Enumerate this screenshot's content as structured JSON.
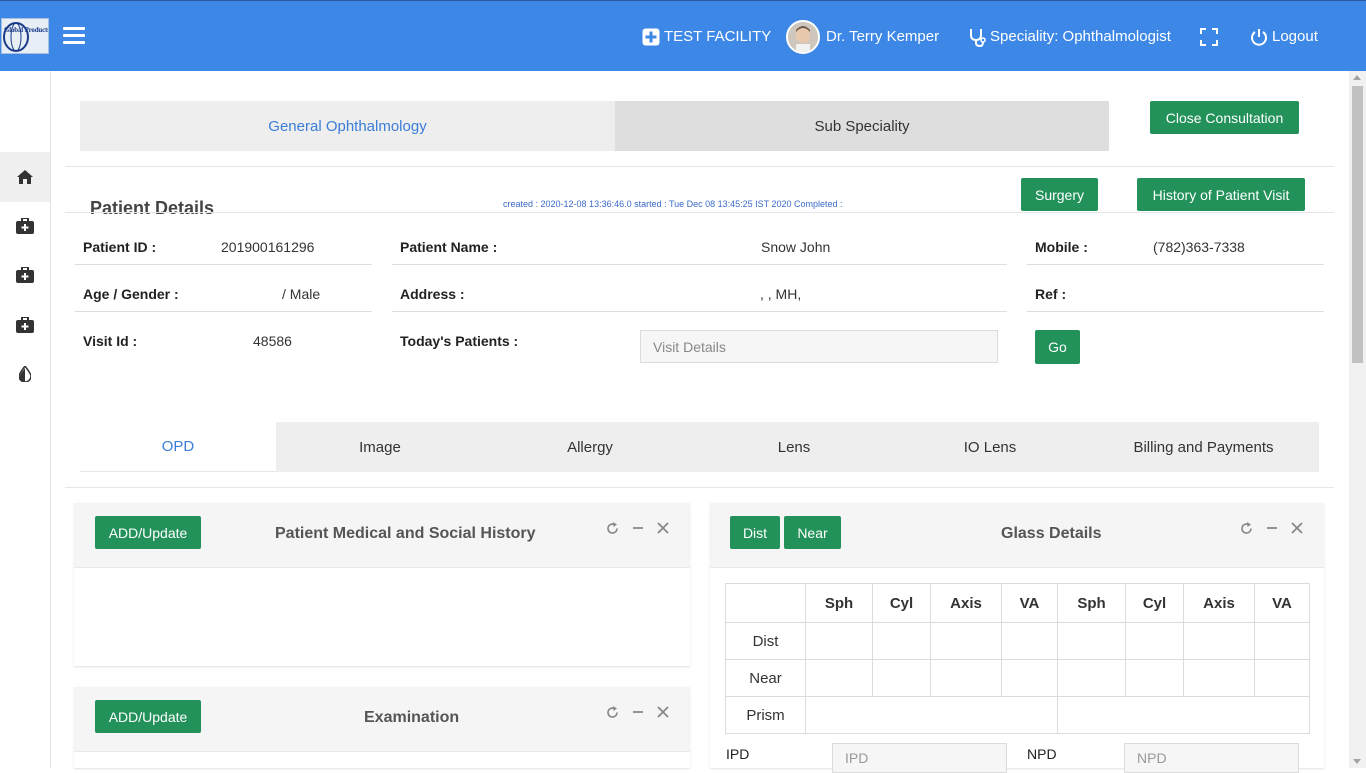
{
  "header": {
    "logo_text": "Global Products",
    "facility": "TEST FACILITY",
    "doctor": "Dr. Terry Kemper",
    "speciality": "Speciality: Ophthalmologist",
    "logout": "Logout"
  },
  "sidebar": {
    "items": [
      {
        "icon": "home-icon"
      },
      {
        "icon": "medical-kit-icon"
      },
      {
        "icon": "medical-kit-icon"
      },
      {
        "icon": "medical-kit-icon"
      },
      {
        "icon": "drop-icon"
      }
    ]
  },
  "speciality_tabs": [
    {
      "label": "General Ophthalmology",
      "active": true
    },
    {
      "label": "Sub Speciality",
      "active": false
    }
  ],
  "buttons": {
    "close_consultation": "Close Consultation",
    "surgery": "Surgery",
    "history": "History of Patient Visit",
    "go": "Go"
  },
  "patient_details": {
    "title": "Patient Details",
    "meta": "created : 2020-12-08 13:36:46.0  started : Tue Dec 08 13:45:25 IST 2020  Completed :",
    "patient_id_label": "Patient ID :",
    "patient_id": "201900161296",
    "patient_name_label": "Patient Name :",
    "patient_name": "Snow John",
    "mobile_label": "Mobile :",
    "mobile": "(782)363-7338",
    "age_gender_label": "Age / Gender :",
    "age_gender": "/ Male",
    "address_label": "Address :",
    "address": ", , MH,",
    "ref_label": "Ref :",
    "visit_id_label": "Visit Id :",
    "visit_id": "48586",
    "todays_patients_label": "Today's Patients :",
    "visit_details_placeholder": "Visit Details"
  },
  "opd_tabs": [
    {
      "label": "OPD",
      "active": true
    },
    {
      "label": "Image",
      "active": false
    },
    {
      "label": "Allergy",
      "active": false
    },
    {
      "label": "Lens",
      "active": false
    },
    {
      "label": "IO Lens",
      "active": false
    },
    {
      "label": "Billing and Payments",
      "active": false
    }
  ],
  "panels": {
    "history": {
      "add_label": "ADD/Update",
      "title": "Patient Medical and Social History"
    },
    "examination": {
      "add_label": "ADD/Update",
      "title": "Examination"
    },
    "glass": {
      "dist_label": "Dist",
      "near_label": "Near",
      "title": "Glass Details",
      "columns": [
        "Sph",
        "Cyl",
        "Axis",
        "VA",
        "Sph",
        "Cyl",
        "Axis",
        "VA"
      ],
      "rows": [
        "Dist",
        "Near",
        "Prism"
      ],
      "ipd_label": "IPD",
      "ipd_placeholder": "IPD",
      "npd_label": "NPD",
      "npd_placeholder": "NPD"
    }
  },
  "colors": {
    "header_bg": "#3d88e6",
    "button_green": "#22925a",
    "active_tab_text": "#3b7dd8"
  }
}
